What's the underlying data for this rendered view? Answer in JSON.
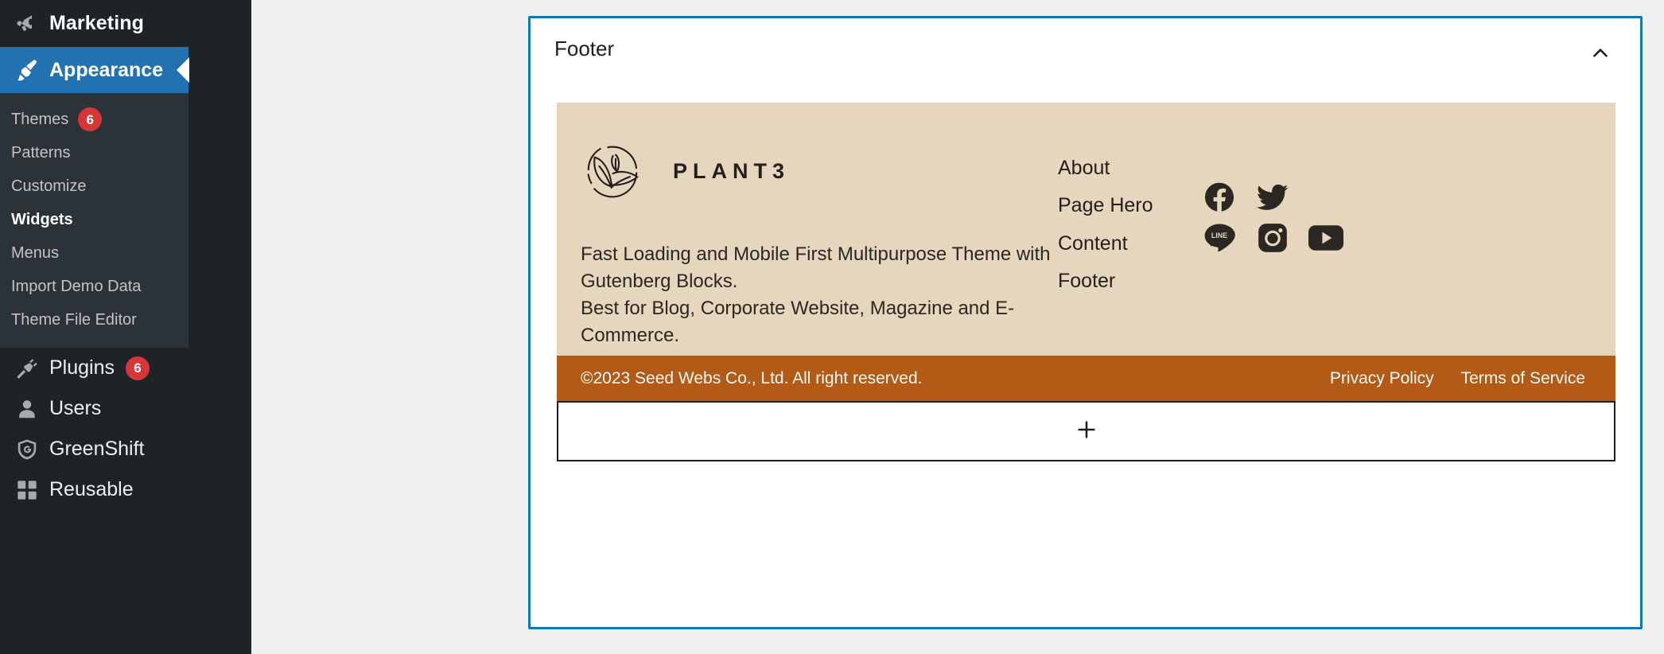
{
  "sidebar": {
    "top_item": {
      "label": "Marketing",
      "icon": "megaphone-icon"
    },
    "current_item": {
      "label": "Appearance",
      "icon": "paintbrush-icon"
    },
    "submenu": [
      {
        "label": "Themes",
        "badge": "6",
        "current": false
      },
      {
        "label": "Patterns",
        "badge": "",
        "current": false
      },
      {
        "label": "Customize",
        "badge": "",
        "current": false
      },
      {
        "label": "Widgets",
        "badge": "",
        "current": true
      },
      {
        "label": "Menus",
        "badge": "",
        "current": false
      },
      {
        "label": "Import Demo Data",
        "badge": "",
        "current": false
      },
      {
        "label": "Theme File Editor",
        "badge": "",
        "current": false
      }
    ],
    "items": [
      {
        "label": "Plugins",
        "badge": "6",
        "icon": "plug-icon"
      },
      {
        "label": "Users",
        "badge": "",
        "icon": "user-icon"
      },
      {
        "label": "GreenShift",
        "badge": "",
        "icon": "greenshift-shield-icon"
      },
      {
        "label": "Reusable",
        "badge": "",
        "icon": "blocks-grid-icon"
      }
    ],
    "colors": {
      "background": "#1d2327",
      "submenu_background": "#2c3338",
      "active": "#2271b1",
      "badge": "#d63638"
    }
  },
  "panel": {
    "title": "Footer",
    "collapse_icon": "chevron-up-icon",
    "border_color": "#1278b4"
  },
  "footer_preview": {
    "background": "#e5d6bd",
    "bar_background": "#b25a16",
    "brand": {
      "logo_icon": "plant-leaf-circle-logo",
      "name": "PLANT3"
    },
    "description": [
      "Fast Loading and Mobile First Multipurpose Theme with Gutenberg Blocks.",
      "Best for Blog, Corporate Website, Magazine and E-Commerce."
    ],
    "links": [
      "About",
      "Page Hero",
      "Content",
      "Footer"
    ],
    "socials": [
      [
        {
          "name": "facebook-icon",
          "label": "Facebook"
        },
        {
          "name": "twitter-icon",
          "label": "Twitter"
        }
      ],
      [
        {
          "name": "line-icon",
          "label": "LINE"
        },
        {
          "name": "instagram-icon",
          "label": "Instagram"
        },
        {
          "name": "youtube-icon",
          "label": "YouTube"
        }
      ]
    ],
    "copyright": "©2023 Seed Webs Co., Ltd. All right reserved.",
    "legal": [
      "Privacy Policy",
      "Terms of Service"
    ]
  },
  "add_block": {
    "icon": "plus-icon",
    "label": "+"
  }
}
